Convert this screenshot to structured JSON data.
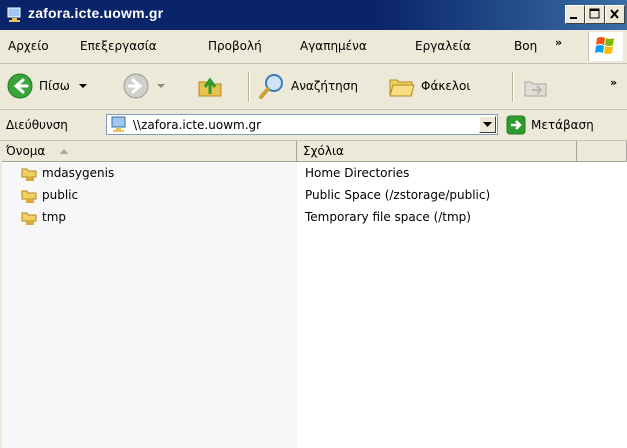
{
  "window": {
    "title": "zafora.icte.uowm.gr",
    "app_icon": "network-folder-icon",
    "buttons": {
      "minimize": "minimize-icon",
      "maximize": "maximize-icon",
      "close": "close-icon"
    }
  },
  "menubar": {
    "items": [
      {
        "label": "Αρχείο"
      },
      {
        "label": "Επεξεργασία"
      },
      {
        "label": "Προβολή"
      },
      {
        "label": "Αγαπημένα"
      },
      {
        "label": "Εργαλεία"
      },
      {
        "label": "Βοη"
      }
    ],
    "overflow": "»"
  },
  "toolbar": {
    "back_label": "Πίσω",
    "search_label": "Αναζήτηση",
    "folders_label": "Φάκελοι",
    "overflow": "»"
  },
  "address": {
    "label": "Διεύθυνση",
    "value": "\\\\zafora.icte.uowm.gr",
    "go_label": "Μετάβαση"
  },
  "list": {
    "columns": [
      {
        "label": "Όνομα",
        "sort": "ascending"
      },
      {
        "label": "Σχόλια"
      }
    ],
    "rows": [
      {
        "name": "mdasygenis",
        "comment": "Home Directories"
      },
      {
        "name": "public",
        "comment": "Public Space (/zstorage/public)"
      },
      {
        "name": "tmp",
        "comment": "Temporary file space (/tmp)"
      }
    ]
  },
  "colors": {
    "titlebar": "#0a246a",
    "chrome": "#ece9d8",
    "accent_green": "#2e9b2e"
  }
}
